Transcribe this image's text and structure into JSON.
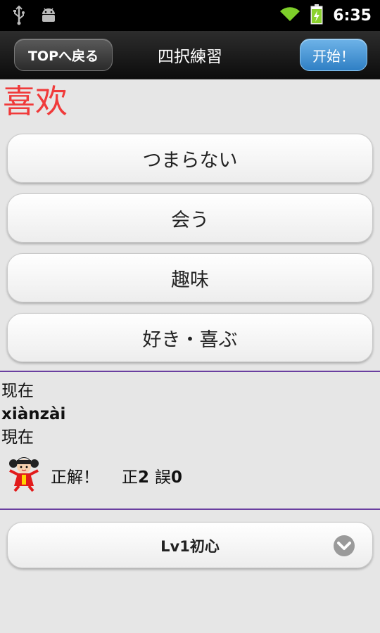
{
  "status_bar": {
    "time": "6:35",
    "icons": [
      "usb-icon",
      "android-icon",
      "wifi-icon",
      "battery-charging-icon"
    ]
  },
  "header": {
    "back_label": "TOPへ戻る",
    "title": "四択練習",
    "start_label": "开始！"
  },
  "question": {
    "word": "喜欢",
    "color": "#f03a3a"
  },
  "choices": [
    {
      "label": "つまらない"
    },
    {
      "label": "会う"
    },
    {
      "label": "趣味"
    },
    {
      "label": "好き・喜ぶ"
    }
  ],
  "info": {
    "word": "现在",
    "pinyin": "xiànzài",
    "meaning": "現在",
    "result": "正解！",
    "correct_label": "正",
    "correct_count": "2",
    "wrong_label": "誤",
    "wrong_count": "0",
    "mascot_icon": "girl-mascot-icon"
  },
  "level_select": {
    "value": "Lv1初心",
    "icon": "chevron-down-icon"
  },
  "colors": {
    "divider": "#6a3fa0",
    "start_button": "#3a8ad0"
  }
}
